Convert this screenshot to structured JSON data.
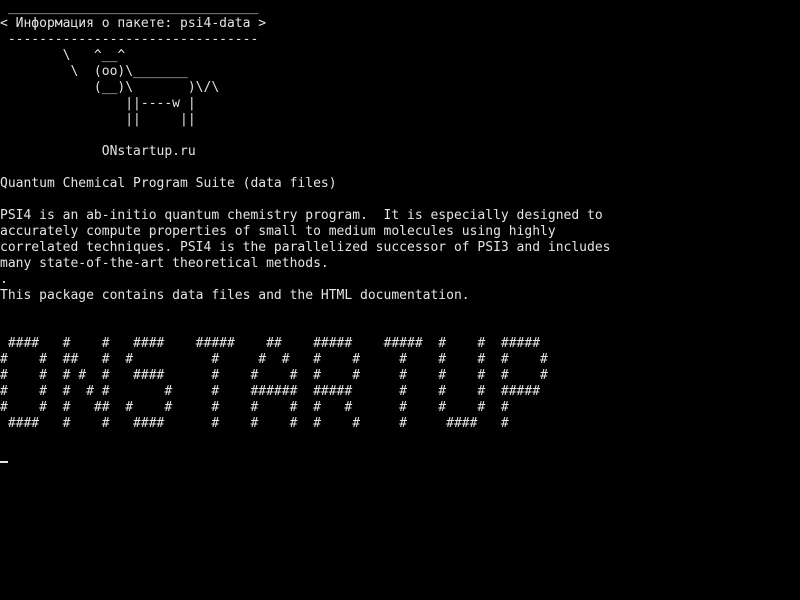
{
  "terminal": {
    "bubble": [
      " ________________________________",
      "< Информация о пакете: psi4-data >",
      " --------------------------------"
    ],
    "cow": [
      "        \\   ^__^",
      "         \\  (oo)\\_______",
      "            (__)\\       )\\/\\",
      "                ||----w |",
      "                ||     ||"
    ],
    "website": "             ONstartup.ru",
    "summary": "Quantum Chemical Program Suite (data files)",
    "description": [
      "PSI4 is an ab-initio quantum chemistry program.  It is especially designed to",
      "accurately compute properties of small to medium molecules using highly",
      "correlated techniques. PSI4 is the parallelized successor of PSI3 and includes",
      "many state-of-the-art theoretical methods.",
      "."
    ],
    "note": "This package contains data files and the HTML documentation.",
    "banner": [
      " ####   #    #   ####    #####    ##    #####    #####  #    #  #####",
      "#    #  ##   #  #          #     #  #   #    #     #    #    #  #    #",
      "#    #  # #  #   ####      #    #    #  #    #     #    #    #  #    #",
      "#    #  #  # #       #     #    ######  #####      #    #    #  #####",
      "#    #  #   ##  #    #     #    #    #  #   #      #    #    #  #",
      " ####   #    #   ####      #    #    #  #    #     #     ####   #"
    ]
  }
}
